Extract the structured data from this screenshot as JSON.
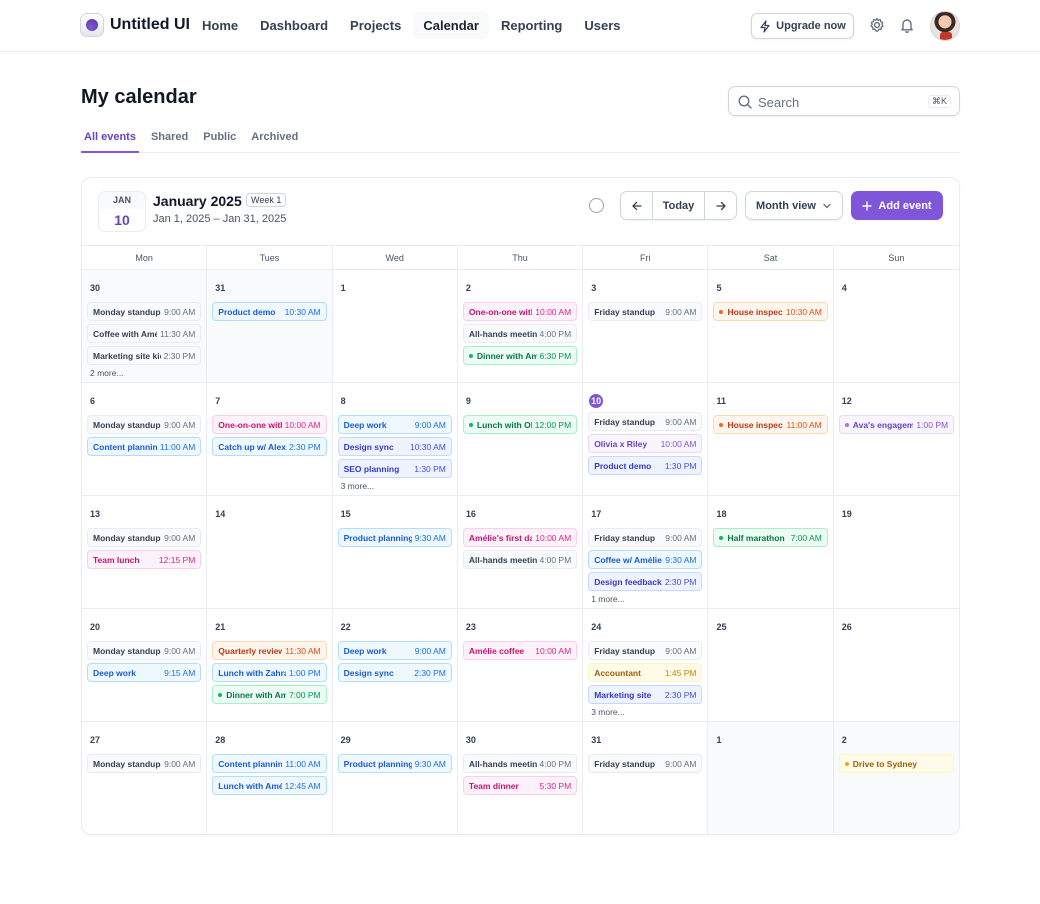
{
  "app": {
    "name": "Untitled UI"
  },
  "nav": [
    "Home",
    "Dashboard",
    "Projects",
    "Calendar",
    "Reporting",
    "Users"
  ],
  "nav_active": "Calendar",
  "header": {
    "upgrade_label": "Upgrade now"
  },
  "page": {
    "title": "My calendar"
  },
  "search": {
    "placeholder": "Search",
    "shortcut": "⌘K"
  },
  "tabs": [
    "All events",
    "Shared",
    "Public",
    "Archived"
  ],
  "tab_active": "All events",
  "calendar": {
    "badge_month": "JAN",
    "badge_day": "10",
    "title": "January 2025",
    "week_label": "Week 1",
    "range": "Jan 1, 2025 – Jan 31, 2025",
    "today_label": "Today",
    "view_label": "Month view",
    "add_label": "Add event",
    "weekdays": [
      "Mon",
      "Tues",
      "Wed",
      "Thu",
      "Fri",
      "Sat",
      "Sun"
    ],
    "weeks": [
      [
        {
          "day": "30",
          "out": true,
          "events": [
            {
              "name": "Monday standup",
              "time": "9:00 AM",
              "color": "gray"
            },
            {
              "name": "Coffee with Amélie",
              "time": "11:30 AM",
              "color": "gray"
            },
            {
              "name": "Marketing site kickoff",
              "time": "2:30 PM",
              "color": "gray"
            }
          ],
          "more": "2 more..."
        },
        {
          "day": "31",
          "out": true,
          "events": [
            {
              "name": "Product demo",
              "time": "10:30 AM",
              "color": "blue"
            }
          ]
        },
        {
          "day": "1",
          "events": []
        },
        {
          "day": "2",
          "events": [
            {
              "name": "One-on-one with Eva",
              "time": "10:00 AM",
              "color": "pink"
            },
            {
              "name": "All-hands meeting",
              "time": "4:00 PM",
              "color": "gray"
            },
            {
              "name": "Dinner with Amélie",
              "time": "6:30 PM",
              "color": "green",
              "dot": true
            }
          ]
        },
        {
          "day": "3",
          "events": [
            {
              "name": "Friday standup",
              "time": "9:00 AM",
              "color": "gray"
            }
          ]
        },
        {
          "day": "5",
          "events": [
            {
              "name": "House inspection",
              "time": "10:30 AM",
              "color": "orange",
              "dot": true
            }
          ]
        },
        {
          "day": "4",
          "events": []
        }
      ],
      [
        {
          "day": "6",
          "events": [
            {
              "name": "Monday standup",
              "time": "9:00 AM",
              "color": "gray"
            },
            {
              "name": "Content planning",
              "time": "11:00 AM",
              "color": "blue"
            }
          ]
        },
        {
          "day": "7",
          "events": [
            {
              "name": "One-on-one with Eva",
              "time": "10:00 AM",
              "color": "pink"
            },
            {
              "name": "Catch up w/ Alex",
              "time": "2:30 PM",
              "color": "blue"
            }
          ]
        },
        {
          "day": "8",
          "events": [
            {
              "name": "Deep work",
              "time": "9:00 AM",
              "color": "blue"
            },
            {
              "name": "Design sync",
              "time": "10:30 AM",
              "color": "indigo"
            },
            {
              "name": "SEO planning",
              "time": "1:30 PM",
              "color": "indigo"
            }
          ],
          "more": "3 more..."
        },
        {
          "day": "9",
          "events": [
            {
              "name": "Lunch with Olivia",
              "time": "12:00 PM",
              "color": "green",
              "dot": true
            }
          ]
        },
        {
          "day": "10",
          "today": true,
          "events": [
            {
              "name": "Friday standup",
              "time": "9:00 AM",
              "color": "gray"
            },
            {
              "name": "Olivia x Riley",
              "time": "10:00 AM",
              "color": "purple"
            },
            {
              "name": "Product demo",
              "time": "1:30 PM",
              "color": "indigo"
            }
          ]
        },
        {
          "day": "11",
          "events": [
            {
              "name": "House inspection",
              "time": "11:00 AM",
              "color": "orange",
              "dot": true
            }
          ]
        },
        {
          "day": "12",
          "events": [
            {
              "name": "Ava's engagement party",
              "time": "1:00 PM",
              "color": "purple",
              "dot": true
            }
          ]
        }
      ],
      [
        {
          "day": "13",
          "events": [
            {
              "name": "Monday standup",
              "time": "9:00 AM",
              "color": "gray"
            },
            {
              "name": "Team lunch",
              "time": "12:15 PM",
              "color": "pink"
            }
          ]
        },
        {
          "day": "14",
          "events": []
        },
        {
          "day": "15",
          "events": [
            {
              "name": "Product planning",
              "time": "9:30 AM",
              "color": "blue"
            }
          ]
        },
        {
          "day": "16",
          "events": [
            {
              "name": "Amélie's first day",
              "time": "10:00 AM",
              "color": "pink"
            },
            {
              "name": "All-hands meeting",
              "time": "4:00 PM",
              "color": "gray"
            }
          ]
        },
        {
          "day": "17",
          "events": [
            {
              "name": "Friday standup",
              "time": "9:00 AM",
              "color": "gray"
            },
            {
              "name": "Coffee w/ Amélie",
              "time": "9:30 AM",
              "color": "blue"
            },
            {
              "name": "Design feedback",
              "time": "2:30 PM",
              "color": "indigo"
            }
          ],
          "more": "1 more..."
        },
        {
          "day": "18",
          "events": [
            {
              "name": "Half marathon",
              "time": "7:00 AM",
              "color": "green",
              "dot": true
            }
          ]
        },
        {
          "day": "19",
          "events": []
        }
      ],
      [
        {
          "day": "20",
          "events": [
            {
              "name": "Monday standup",
              "time": "9:00 AM",
              "color": "gray"
            },
            {
              "name": "Deep work",
              "time": "9:15 AM",
              "color": "blue"
            }
          ]
        },
        {
          "day": "21",
          "events": [
            {
              "name": "Quarterly review",
              "time": "11:30 AM",
              "color": "orange"
            },
            {
              "name": "Lunch with Zahra",
              "time": "1:00 PM",
              "color": "blue"
            },
            {
              "name": "Dinner with Amélie",
              "time": "7:00 PM",
              "color": "green",
              "dot": true
            }
          ]
        },
        {
          "day": "22",
          "events": [
            {
              "name": "Deep work",
              "time": "9:00 AM",
              "color": "blue"
            },
            {
              "name": "Design sync",
              "time": "2:30 PM",
              "color": "blue"
            }
          ]
        },
        {
          "day": "23",
          "events": [
            {
              "name": "Amélie coffee",
              "time": "10:00 AM",
              "color": "pink"
            }
          ]
        },
        {
          "day": "24",
          "events": [
            {
              "name": "Friday standup",
              "time": "9:00 AM",
              "color": "gray"
            },
            {
              "name": "Accountant",
              "time": "1:45 PM",
              "color": "yellow"
            },
            {
              "name": "Marketing site",
              "time": "2:30 PM",
              "color": "indigo"
            }
          ],
          "more": "3 more..."
        },
        {
          "day": "25",
          "events": []
        },
        {
          "day": "26",
          "events": []
        }
      ],
      [
        {
          "day": "27",
          "events": [
            {
              "name": "Monday standup",
              "time": "9:00 AM",
              "color": "gray"
            }
          ]
        },
        {
          "day": "28",
          "events": [
            {
              "name": "Content planning",
              "time": "11:00 AM",
              "color": "blue"
            },
            {
              "name": "Lunch with Amélie",
              "time": "12:45 AM",
              "color": "blue"
            }
          ]
        },
        {
          "day": "29",
          "events": [
            {
              "name": "Product planning",
              "time": "9:30 AM",
              "color": "blue"
            }
          ]
        },
        {
          "day": "30",
          "events": [
            {
              "name": "All-hands meeting",
              "time": "4:00 PM",
              "color": "gray"
            },
            {
              "name": "Team dinner",
              "time": "5:30 PM",
              "color": "pink"
            }
          ]
        },
        {
          "day": "31",
          "events": [
            {
              "name": "Friday standup",
              "time": "9:00 AM",
              "color": "gray"
            }
          ]
        },
        {
          "day": "1",
          "out": true,
          "events": []
        },
        {
          "day": "2",
          "out": true,
          "events": [
            {
              "name": "Drive to Sydney",
              "time": "",
              "color": "yellow",
              "dot": true
            }
          ]
        }
      ]
    ]
  },
  "colors": {
    "brand": "#7f56d9",
    "brand_dark": "#6941c6"
  }
}
